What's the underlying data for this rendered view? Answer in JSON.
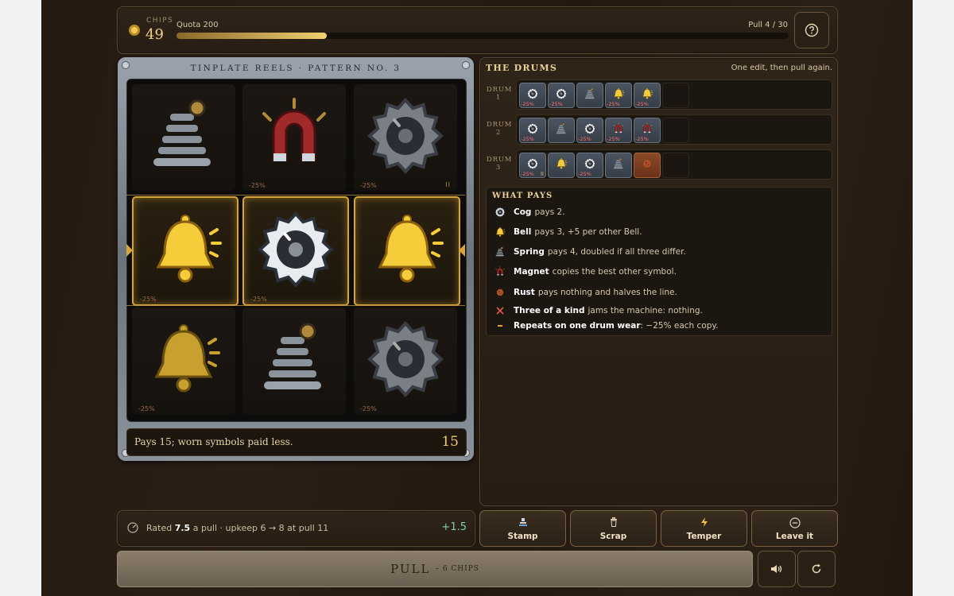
{
  "topbar": {
    "chips_label": "CHIPS",
    "chips_value": "49",
    "quota_label": "Quota 200",
    "pull_label": "Pull 4 / 30",
    "quota_progress": 0.245,
    "help_icon": "question-circle-icon"
  },
  "machine": {
    "title": "TINPLATE REELS · PATTERN NO. 3",
    "grid": [
      [
        {
          "symbol": "spring",
          "wear": ""
        },
        {
          "symbol": "magnet",
          "wear": "-25%"
        },
        {
          "symbol": "cog",
          "wear": "-25%",
          "mark": "II"
        }
      ],
      [
        {
          "symbol": "bell",
          "wear": "-25%",
          "win": true
        },
        {
          "symbol": "cog",
          "wear": "-25%",
          "win": true
        },
        {
          "symbol": "bell",
          "wear": "",
          "win": true
        }
      ],
      [
        {
          "symbol": "bell",
          "wear": "-25%"
        },
        {
          "symbol": "spring",
          "wear": ""
        },
        {
          "symbol": "cog",
          "wear": "-25%"
        }
      ]
    ],
    "result_text": "Pays 15; worn symbols paid less.",
    "result_value": "15"
  },
  "drums": {
    "title": "THE DRUMS",
    "subtitle": "One edit, then pull again.",
    "rows": [
      {
        "label_word": "DRUM",
        "label_num": "1",
        "tiles": [
          {
            "symbol": "cog",
            "wear": "-25%"
          },
          {
            "symbol": "cog",
            "wear": "-25%"
          },
          {
            "symbol": "spring",
            "wear": ""
          },
          {
            "symbol": "bell",
            "wear": "-25%"
          },
          {
            "symbol": "bell",
            "wear": "-25%"
          },
          {
            "symbol": "empty"
          }
        ]
      },
      {
        "label_word": "DRUM",
        "label_num": "2",
        "tiles": [
          {
            "symbol": "cog",
            "wear": "-25%"
          },
          {
            "symbol": "spring",
            "wear": ""
          },
          {
            "symbol": "cog",
            "wear": "-25%"
          },
          {
            "symbol": "magnet",
            "wear": "-25%"
          },
          {
            "symbol": "magnet",
            "wear": "-25%"
          },
          {
            "symbol": "empty"
          }
        ]
      },
      {
        "label_word": "DRUM",
        "label_num": "3",
        "tiles": [
          {
            "symbol": "cog",
            "wear": "-25%",
            "mark": "II"
          },
          {
            "symbol": "bell",
            "wear": ""
          },
          {
            "symbol": "cog",
            "wear": "-25%"
          },
          {
            "symbol": "spring",
            "wear": ""
          },
          {
            "symbol": "rust",
            "wear": ""
          },
          {
            "symbol": "empty"
          }
        ]
      }
    ]
  },
  "pays": {
    "title": "WHAT PAYS",
    "items": [
      {
        "icon": "cog-icon",
        "name": "Cog",
        "text": "pays 2."
      },
      {
        "icon": "bell-icon",
        "name": "Bell",
        "text": "pays 3, +5 per other Bell."
      },
      {
        "icon": "spring-icon",
        "name": "Spring",
        "text": "pays 4, doubled if all three differ."
      },
      {
        "icon": "magnet-icon",
        "name": "Magnet",
        "text": "copies the best other symbol."
      },
      {
        "icon": "rust-icon",
        "name": "Rust",
        "text": "pays nothing and halves the line."
      },
      {
        "icon": "cross-icon",
        "name": "Three of a kind",
        "text": "jams the machine: nothing."
      },
      {
        "icon": "dash-icon",
        "name": "Repeats on one drum wear",
        "text": ": −25% each copy."
      }
    ]
  },
  "rating": {
    "prefix": "Rated",
    "value": "7.5",
    "suffix": "a pull · upkeep 6 → 8 at pull 11",
    "delta": "+1.5"
  },
  "actions": [
    {
      "label": "Stamp",
      "icon": "stamp-icon"
    },
    {
      "label": "Scrap",
      "icon": "trash-icon"
    },
    {
      "label": "Temper",
      "icon": "bolt-icon"
    },
    {
      "label": "Leave it",
      "icon": "minus-circle-icon"
    }
  ],
  "pull": {
    "label": "PULL",
    "cost": "– 6 CHIPS"
  },
  "colors": {
    "accent": "#d6a53a",
    "gold": "#f0d070",
    "win": "#7ed0a0",
    "wear": "#ff7070"
  }
}
